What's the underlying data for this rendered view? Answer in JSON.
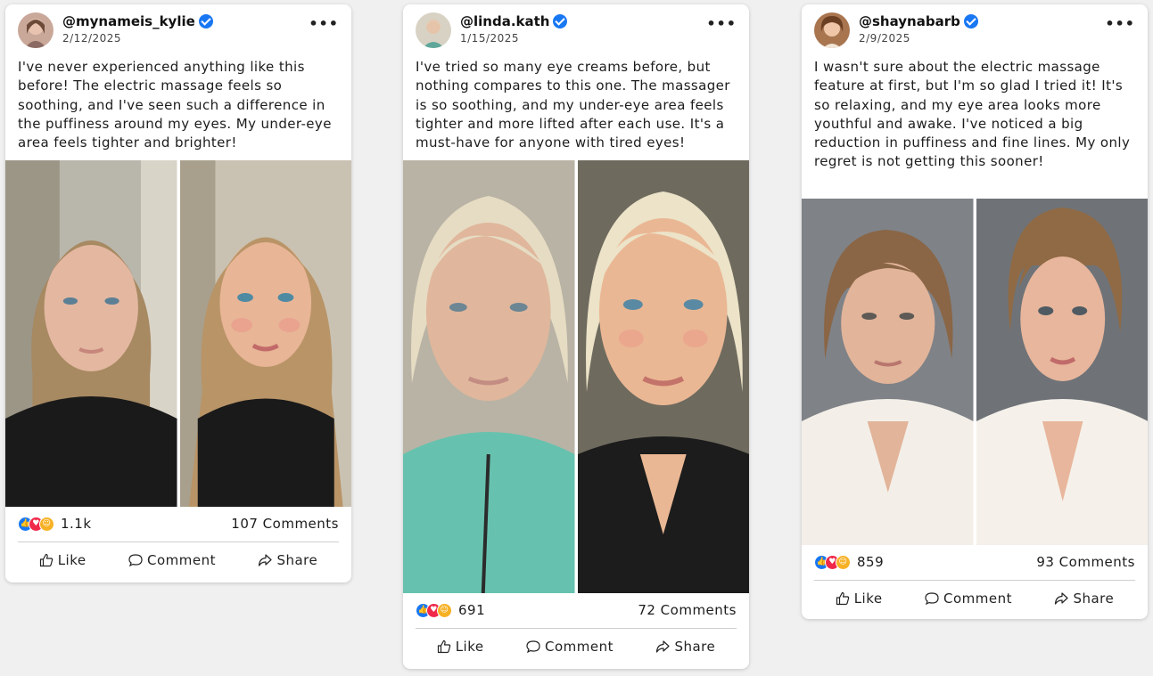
{
  "posts": [
    {
      "handle": "@mynameis_kylie",
      "date": "2/12/2025",
      "text": "I've never experienced anything like this before! The electric massage feels so soothing, and I've seen such a difference in the puffiness around my eyes. My under-eye area feels tighter and brighter!",
      "reactions": "1.1k",
      "comments": "107 Comments"
    },
    {
      "handle": "@linda.kath",
      "date": "1/15/2025",
      "text": "I've tried so many eye creams before, but nothing compares to this one. The massager is so soothing, and my under-eye area feels tighter and more lifted after each use. It's a must-have for anyone with tired eyes!",
      "reactions": "691",
      "comments": "72 Comments"
    },
    {
      "handle": "@shaynabarb",
      "date": "2/9/2025",
      "text": "I wasn't sure about the electric massage feature at first, but I'm so glad I tried it! It's so relaxing, and my eye area looks more youthful and awake. I've noticed a big reduction in puffiness and fine lines. My only regret is not getting this sooner!",
      "reactions": "859",
      "comments": "93 Comments"
    }
  ],
  "actions": {
    "like": "Like",
    "comment": "Comment",
    "share": "Share"
  },
  "icons": {
    "more": "more-options-icon",
    "verified": "verified-badge-icon",
    "like": "thumbs-up-icon",
    "comment": "comment-bubble-icon",
    "share": "share-arrow-icon"
  },
  "colors": {
    "verified": "#1877f2",
    "like_reaction": "#1877f2",
    "love_reaction": "#f0284a",
    "care_reaction": "#f7b125"
  }
}
